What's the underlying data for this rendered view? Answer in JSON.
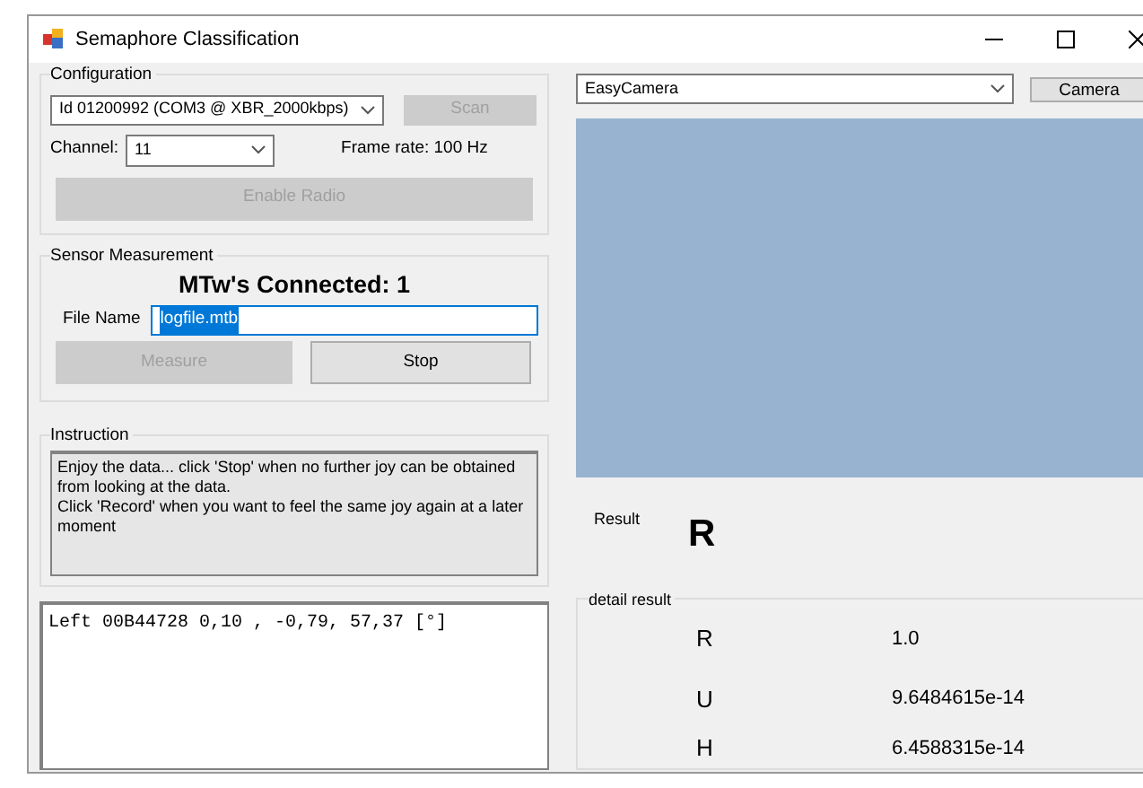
{
  "window": {
    "title": "Semaphore Classification"
  },
  "configuration": {
    "title": "Configuration",
    "device": {
      "value": "Id 01200992 (COM3 @ XBR_2000kbps)"
    },
    "scan_button": {
      "label": "Scan",
      "disabled": true
    },
    "channel_label": "Channel:",
    "channel": {
      "value": "11"
    },
    "frame_rate": "Frame rate: 100 Hz",
    "enable_radio_button": {
      "label": "Enable Radio",
      "disabled": true
    }
  },
  "sensor_measurement": {
    "title": "Sensor Measurement",
    "connected": "MTw's Connected: 1",
    "file_name_label": "File Name",
    "file_name": {
      "value": "logfile.mtb",
      "selected": true
    },
    "measure_button": {
      "label": "Measure",
      "disabled": true
    },
    "stop_button": {
      "label": "Stop",
      "disabled": false
    }
  },
  "instruction": {
    "title": "Instruction",
    "lines": [
      "Enjoy the data... click 'Stop' when no further joy can be obtained from looking at the data.",
      "Click 'Record' when you want to feel the same joy again at a later moment"
    ]
  },
  "log": {
    "lines": [
      "Left 00B44728 0,10 , -0,79, 57,37 [°]"
    ]
  },
  "camera": {
    "source": {
      "value": "EasyCamera"
    },
    "button": {
      "label": "Camera"
    }
  },
  "result": {
    "label": "Result",
    "value": "R"
  },
  "detail_result": {
    "title": "detail result",
    "rows": [
      {
        "label": "R",
        "value": "1.0"
      },
      {
        "label": "U",
        "value": "9.6484615e-14"
      },
      {
        "label": "H",
        "value": "6.4588315e-14"
      }
    ]
  }
}
